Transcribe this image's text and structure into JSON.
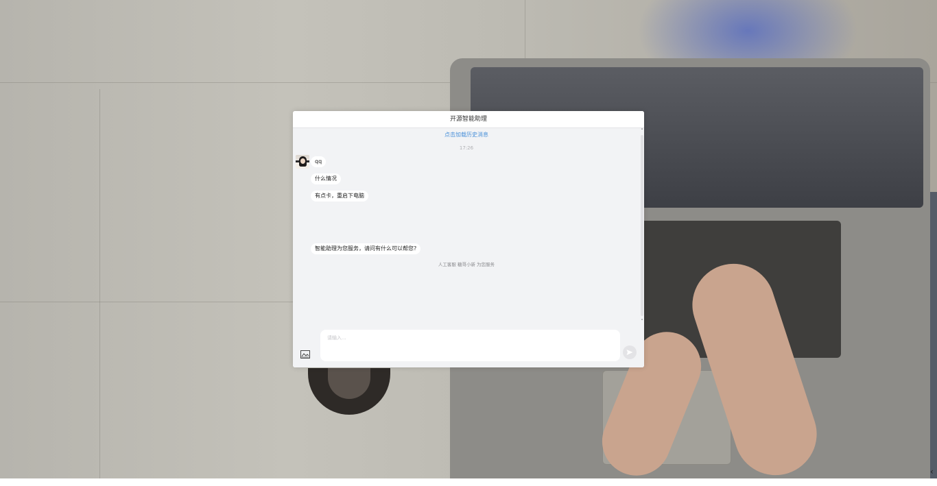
{
  "chat": {
    "title": "开源智能助理",
    "load_history": "点击加载历史消息",
    "time": "17:26",
    "messages": [
      {
        "text": "qq"
      },
      {
        "text": "什么情况"
      },
      {
        "text": "有点卡，重启下电脑"
      },
      {
        "text": "智能助理为您服务，请问有什么可以帮您?"
      }
    ],
    "notice": "人工客服 糖哥小新 为您服务",
    "input_placeholder": "请输入...",
    "icons": {
      "image": "image-icon",
      "send": "send-icon",
      "scroll_up": "chevron-up-icon",
      "scroll_down": "chevron-down-icon"
    },
    "colors": {
      "link": "#4a90d9",
      "bubble": "#ffffff",
      "body": "#f2f3f5"
    }
  }
}
